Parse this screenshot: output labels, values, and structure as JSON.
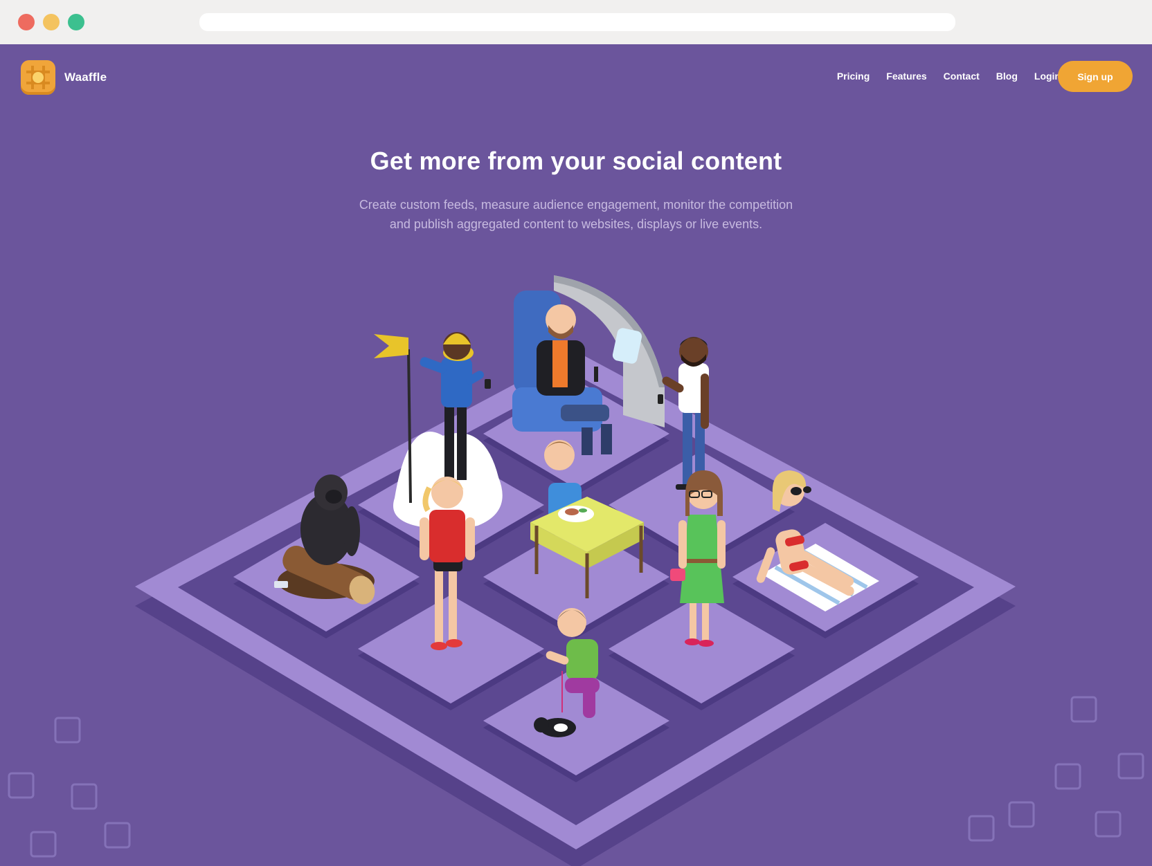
{
  "browser": {
    "window_controls": [
      "close",
      "minimize",
      "maximize"
    ],
    "address_bar": ""
  },
  "brand": {
    "name": "Waaffle",
    "logo_icon": "waffle-icon"
  },
  "nav": {
    "items": [
      "Pricing",
      "Features",
      "Contact",
      "Blog",
      "Login"
    ],
    "cta_label": "Sign up"
  },
  "hero": {
    "title": "Get more from your social content",
    "subtitle_line1": "Create custom feeds, measure audience engagement, monitor the competition",
    "subtitle_line2": "and publish aggregated content to websites, displays or live events."
  },
  "illustration": {
    "icon": "isometric-social-grid-illustration",
    "tiles": 9,
    "scenes": [
      "gorilla-on-log",
      "climber-with-flag-on-snow",
      "airplane-passenger",
      "man-with-phone",
      "girl-in-red-shirt",
      "man-at-picnic-table",
      "woman-in-green-dress",
      "woman-sunbathing",
      "man-with-cat"
    ]
  },
  "colors": {
    "page_background": "#6b559c",
    "cta": "#f0a534",
    "tile_light": "#a18ad3",
    "tile_dark": "#5c4891",
    "subtitle": "#c7bae0"
  }
}
